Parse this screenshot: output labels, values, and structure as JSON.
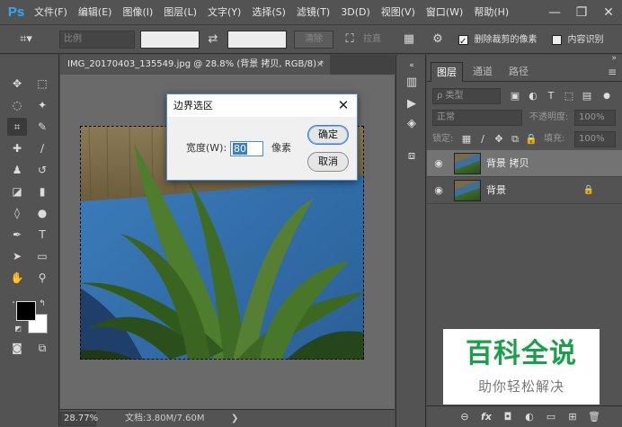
{
  "app": {
    "logo": "Ps",
    "menu": [
      "文件(F)",
      "编辑(E)",
      "图像(I)",
      "图层(L)",
      "文字(Y)",
      "选择(S)",
      "滤镜(T)",
      "3D(D)",
      "视图(V)",
      "窗口(W)",
      "帮助(H)"
    ],
    "window_controls": [
      "—",
      "❐",
      "✕"
    ]
  },
  "options_bar": {
    "ratio_label": "比例",
    "clear_button": "清除",
    "straighten_label": "拉直",
    "delete_cropped_label": "删除裁剪的像素",
    "delete_cropped_checked": true,
    "swap_icon": "⇄",
    "content_aware_label": "内容识别"
  },
  "document": {
    "tab_title": "IMG_20170403_135549.jpg @ 28.8% (背景 拷贝, RGB/8) *",
    "tab_close": "×",
    "zoom": "28.77%",
    "doc_info": "文档:3.80M/7.60M",
    "status_arrow": "❯"
  },
  "dialog": {
    "title": "边界选区",
    "close": "✕",
    "width_label": "宽度(W):",
    "width_value": "80",
    "unit": "像素",
    "ok": "确定",
    "cancel": "取消"
  },
  "layers_panel": {
    "tabs": [
      "图层",
      "通道",
      "路径"
    ],
    "active_tab": 0,
    "menu": "≡",
    "filter_label": "ρ 类型",
    "blend_mode": "正常",
    "opacity_label": "不透明度:",
    "opacity_value": "100%",
    "lock_label": "锁定:",
    "fill_label": "填充:",
    "fill_value": "100%",
    "layers": [
      {
        "name": "背景 拷贝",
        "visible": true,
        "selected": true,
        "locked": false
      },
      {
        "name": "背景",
        "visible": true,
        "selected": false,
        "locked": true
      }
    ],
    "footer_icons": [
      "link-icon",
      "fx-icon",
      "mask-icon",
      "adjustment-icon",
      "folder-icon",
      "new-layer-icon",
      "trash-icon"
    ],
    "footer_glyphs": [
      "⊖",
      "fx",
      "◘",
      "◐",
      "▭",
      "⊞",
      "🗑"
    ]
  },
  "watermark": {
    "title": "百科全说",
    "subtitle": "助你轻松解决"
  },
  "colors": {
    "foreground": "#000000",
    "background": "#ffffff",
    "ps_blue": "#31a8ff",
    "watermark_green": "#1aa04a"
  }
}
